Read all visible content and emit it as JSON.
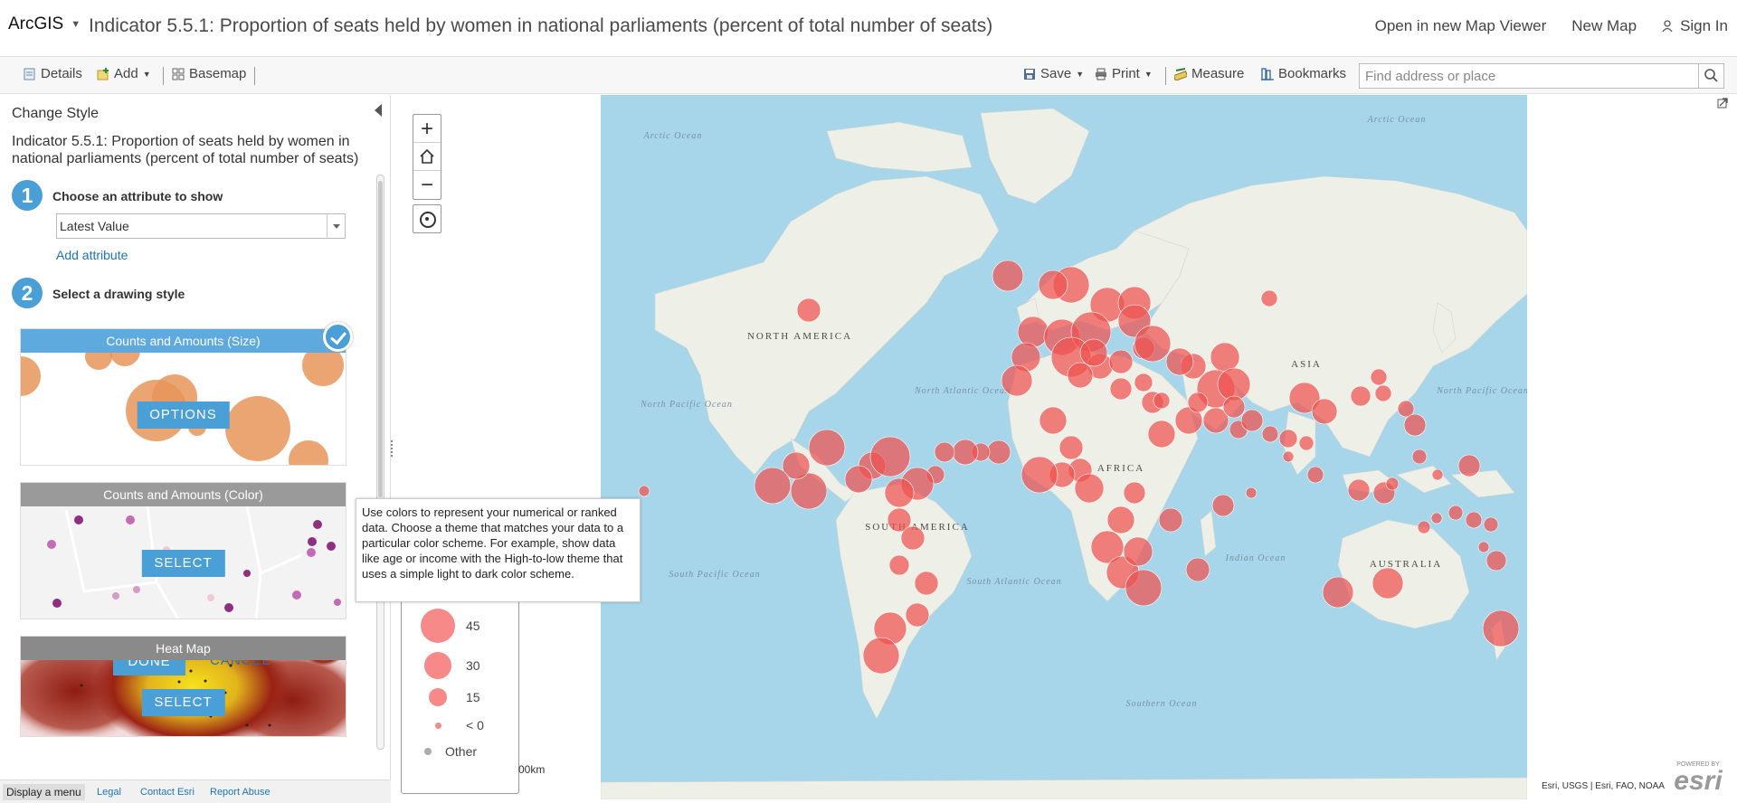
{
  "header": {
    "brand": "ArcGIS",
    "title": "Indicator 5.5.1: Proportion of seats held by women in national parliaments (percent of total number of seats)",
    "links": {
      "open_viewer": "Open in new Map Viewer",
      "new_map": "New Map",
      "sign_in": "Sign In"
    }
  },
  "toolbar": {
    "details": "Details",
    "add": "Add",
    "basemap": "Basemap",
    "save": "Save",
    "print": "Print",
    "measure": "Measure",
    "bookmarks": "Bookmarks",
    "search_placeholder": "Find address or place"
  },
  "panel": {
    "title": "Change Style",
    "layer_name": "Indicator 5.5.1: Proportion of seats held by women in national parliaments (percent of total number of seats)",
    "step1": {
      "number": "1",
      "label": "Choose an attribute to show",
      "selected": "Latest Value",
      "add_attribute": "Add attribute"
    },
    "step2": {
      "number": "2",
      "label": "Select a drawing style"
    },
    "styles": [
      {
        "title": "Counts and Amounts (Size)",
        "button": "OPTIONS",
        "selected": true
      },
      {
        "title": "Counts and Amounts (Color)",
        "button": "SELECT",
        "selected": false
      },
      {
        "title": "Heat Map",
        "button": "SELECT",
        "selected": false
      }
    ],
    "done": "DONE",
    "cancel": "CANCEL"
  },
  "footer": {
    "menu": "Display a menu",
    "legal": "Legal",
    "contact": "Contact Esri",
    "report": "Report Abuse"
  },
  "tooltip": "Use colors to represent your numerical or ranked data. Choose a theme that matches your data to a particular color scheme. For example, show data like age or income with the High-to-low theme that uses a simple light to dark color scheme.",
  "legend": {
    "items": [
      {
        "label": "45"
      },
      {
        "label": "30"
      },
      {
        "label": "15"
      },
      {
        "label": "< 0"
      },
      {
        "label": "Other"
      }
    ],
    "scale": "00km"
  },
  "map": {
    "labels": {
      "arctic_left": "Arctic Ocean",
      "arctic_right": "Arctic Ocean",
      "north_america": "NORTH AMERICA",
      "north_pacific_left": "North Pacific Ocean",
      "north_atlantic": "North Atlantic Ocean",
      "asia": "ASIA",
      "north_pacific_right": "North Pacific Ocean",
      "africa": "AFRICA",
      "south_america": "SOUTH AMERICA",
      "south_pacific": "South Pacific Ocean",
      "south_atlantic": "South Atlantic Ocean",
      "indian": "Indian Ocean",
      "australia": "AUSTRALIA",
      "southern": "Southern Ocean"
    },
    "attribution": "Esri, USGS | Esri, FAO, NOAA",
    "logo_powered": "POWERED BY",
    "logo_name": "esri",
    "colors": {
      "symbol": "#f0524f",
      "ocean": "#a7d6ea",
      "land": "#eef0e8",
      "accent": "#4a9fd6"
    }
  }
}
